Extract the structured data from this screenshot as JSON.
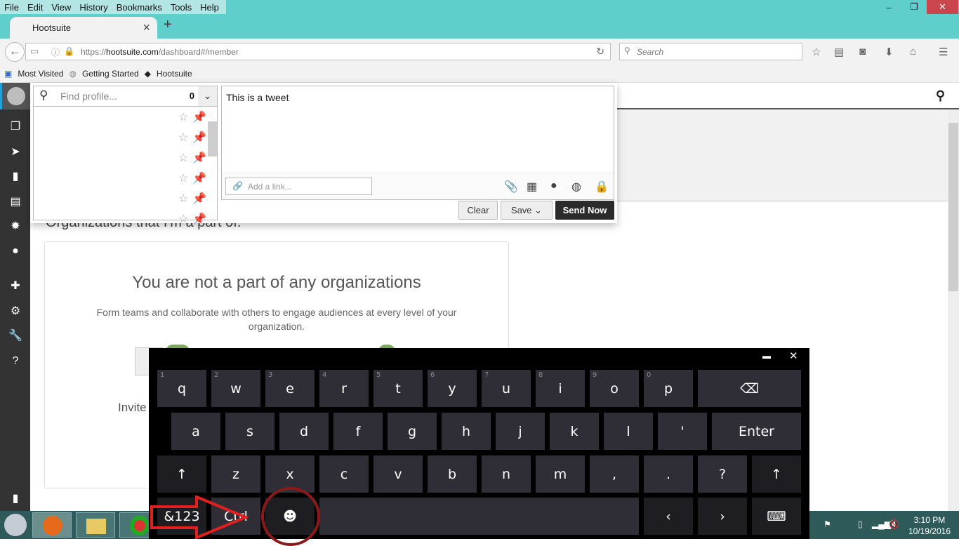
{
  "browser": {
    "menu": [
      "File",
      "Edit",
      "View",
      "History",
      "Bookmarks",
      "Tools",
      "Help"
    ],
    "tab_title": "Hootsuite",
    "url_prefix": "https://",
    "url_host": "hootsuite.com",
    "url_path": "/dashboard#/member",
    "search_placeholder": "Search",
    "bookmarks": [
      "Most Visited",
      "Getting Started",
      "Hootsuite"
    ],
    "window_controls": {
      "minimize": "–",
      "restore": "❐",
      "close": "✕"
    }
  },
  "sidebar": {
    "icons": [
      "streams-icon",
      "publisher-icon",
      "analytics-icon",
      "assignments-icon",
      "contacts-icon",
      "profile-icon",
      "apps-icon",
      "settings-icon",
      "tools-icon",
      "help-icon",
      "logout-icon"
    ]
  },
  "compose": {
    "find_profile_placeholder": "Find profile...",
    "profile_count": "0",
    "message": "This is a tweet ",
    "link_placeholder": "Add a link...",
    "clear_label": "Clear",
    "save_label": "Save",
    "send_label": "Send Now"
  },
  "organizations": {
    "heading": "Organizations that I'm a part of.",
    "empty_title": "You are not a part of any organizations",
    "empty_desc": "Form teams and collaborate with others to engage audiences at every level of your organization.",
    "invite_label": "Invite"
  },
  "keyboard": {
    "row1": [
      {
        "k": "q",
        "h": "1"
      },
      {
        "k": "w",
        "h": "2"
      },
      {
        "k": "e",
        "h": "3"
      },
      {
        "k": "r",
        "h": "4"
      },
      {
        "k": "t",
        "h": "5"
      },
      {
        "k": "y",
        "h": "6"
      },
      {
        "k": "u",
        "h": "7"
      },
      {
        "k": "i",
        "h": "8"
      },
      {
        "k": "o",
        "h": "9"
      },
      {
        "k": "p",
        "h": "0"
      }
    ],
    "row2": [
      "a",
      "s",
      "d",
      "f",
      "g",
      "h",
      "j",
      "k",
      "l",
      "'"
    ],
    "row3": [
      "z",
      "x",
      "c",
      "v",
      "b",
      "n",
      "m",
      ",",
      ".",
      "?"
    ],
    "backspace": "⌫",
    "enter": "Enter",
    "shift": "↑",
    "symbols": "&123",
    "ctrl": "Ctrl",
    "emoji": "☻",
    "left": "‹",
    "right": "›",
    "dock": "⌨",
    "minimize": "▬",
    "close": "✕"
  },
  "taskbar": {
    "time": "3:10 PM",
    "date": "10/19/2016"
  }
}
